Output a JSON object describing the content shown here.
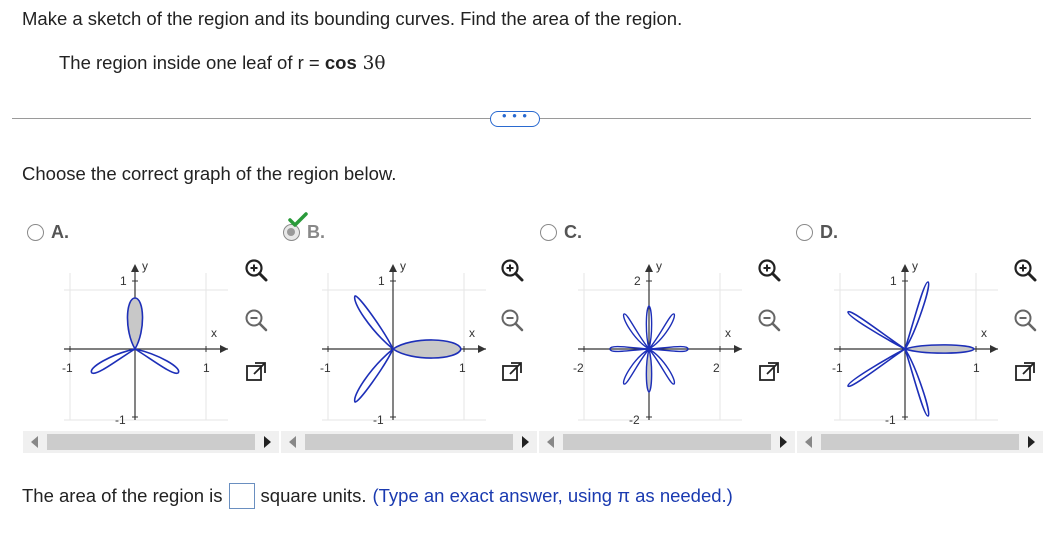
{
  "question": {
    "prompt": "Make a sketch of the region and its bounding curves. Find the area of the region.",
    "subprompt_prefix": "The region inside one leaf of r = ",
    "subprompt_fn": "cos",
    "subprompt_arg": " 3θ"
  },
  "more_button": "• • •",
  "instruction": "Choose the correct graph of the region below.",
  "options": [
    {
      "letter": "A.",
      "selected": false,
      "x_min": "-1",
      "x_max": "1",
      "y_max": "1",
      "y_min": "-1",
      "x_label": "x",
      "y_label": "y"
    },
    {
      "letter": "B.",
      "selected": true,
      "x_min": "-1",
      "x_max": "1",
      "y_max": "1",
      "y_min": "-1",
      "x_label": "x",
      "y_label": "y"
    },
    {
      "letter": "C.",
      "selected": false,
      "x_min": "-2",
      "x_max": "2",
      "y_max": "2",
      "y_min": "-2",
      "x_label": "x",
      "y_label": "y"
    },
    {
      "letter": "D.",
      "selected": false,
      "x_min": "-1",
      "x_max": "1",
      "y_max": "1",
      "y_min": "-1",
      "x_label": "x",
      "y_label": "y"
    }
  ],
  "icons": [
    "zoom-in-icon",
    "zoom-out-icon",
    "open-new-window-icon"
  ],
  "colors": {
    "curve": "#1d2fb8",
    "fill": "#c8c8c8",
    "check": "#2a9a3a",
    "hint": "#1a3ab0"
  },
  "answer": {
    "prefix": "The area of the region is",
    "suffix": "square units.",
    "hint": "(Type an exact answer, using π as needed.)"
  }
}
